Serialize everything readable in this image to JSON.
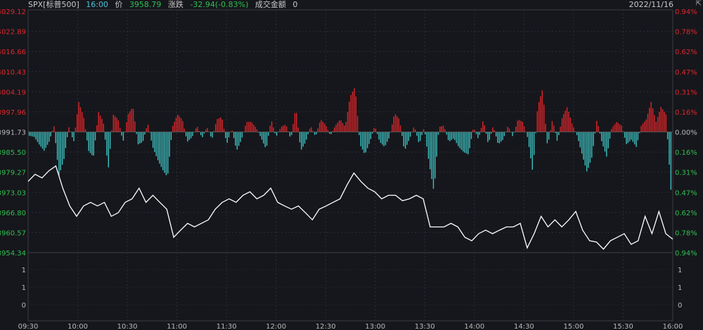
{
  "header": {
    "symbol": "SPX[标普500]",
    "time": "16:00",
    "price_label": "价",
    "price": "3958.79",
    "change_label": "涨跌",
    "change": "-32.94(-0.83%)",
    "turnover_label": "成交金额",
    "turnover": "0",
    "date": "2022/11/16",
    "corner_icon": "expand-icon"
  },
  "colors": {
    "up": "#e0262a",
    "down": "#3ec2c2",
    "line": "#ffffff",
    "grid": "#2c2e36",
    "neutral": "#b8b8b8",
    "green": "#2fbf4f"
  },
  "chart_data": {
    "type": "line",
    "title": "SPX intraday",
    "xlabel": "",
    "ylabel": "",
    "x_ticks": [
      "09:30",
      "10:00",
      "10:30",
      "11:00",
      "11:30",
      "12:00",
      "12:30",
      "13:00",
      "13:30",
      "14:00",
      "14:30",
      "15:00",
      "15:30",
      "16:00"
    ],
    "ylim": [
      3954.34,
      4029.12
    ],
    "prev_close": 3991.73,
    "left_ticks": [
      "4029.12",
      "4022.89",
      "4016.66",
      "4010.43",
      "4004.19",
      "3997.96",
      "3991.73",
      "3985.50",
      "3979.27",
      "3973.03",
      "3966.80",
      "3960.57",
      "3954.34"
    ],
    "right_ticks": [
      "0.94%",
      "0.78%",
      "0.62%",
      "0.47%",
      "0.31%",
      "0.16%",
      "0.00%",
      "0.16%",
      "0.31%",
      "0.47%",
      "0.62%",
      "0.78%",
      "0.94%"
    ],
    "volume_ticks": [
      "1",
      "1",
      "0"
    ],
    "grid": true,
    "price_series": [
      3976.4,
      3978.6,
      3977.5,
      3979.7,
      3981.2,
      3974.3,
      3968.8,
      3965.6,
      3968.8,
      3969.9,
      3968.8,
      3969.9,
      3965.6,
      3966.7,
      3969.9,
      3971.0,
      3974.3,
      3969.9,
      3972.1,
      3969.9,
      3967.8,
      3959.1,
      3961.3,
      3963.4,
      3962.3,
      3963.4,
      3964.5,
      3967.8,
      3969.9,
      3971.0,
      3969.9,
      3972.1,
      3973.2,
      3971.0,
      3972.1,
      3974.3,
      3969.9,
      3968.8,
      3967.8,
      3968.8,
      3966.7,
      3964.5,
      3967.8,
      3968.8,
      3969.9,
      3971.0,
      3975.3,
      3979.0,
      3976.4,
      3974.3,
      3973.2,
      3971.0,
      3972.1,
      3972.1,
      3970.4,
      3971.0,
      3972.1,
      3971.0,
      3962.3,
      3962.3,
      3962.3,
      3963.4,
      3962.3,
      3959.1,
      3958.0,
      3960.2,
      3961.3,
      3960.2,
      3961.3,
      3962.3,
      3962.3,
      3963.4,
      3955.8,
      3960.2,
      3965.6,
      3962.3,
      3964.5,
      3962.3,
      3964.5,
      3967.1,
      3961.3,
      3958.0,
      3957.6,
      3955.4,
      3958.0,
      3959.1,
      3960.2,
      3956.9,
      3958.0,
      3965.6,
      3960.2,
      3967.1,
      3960.2,
      3958.5
    ],
    "series": [
      {
        "name": "change_pct_bars",
        "values": [
          -0.03,
          -0.04,
          -0.1,
          -0.15,
          -0.08,
          0.05,
          -0.35,
          -0.22,
          0.04,
          -0.08,
          0.24,
          0.12,
          -0.15,
          -0.2,
          0.16,
          0.08,
          -0.3,
          0.14,
          0.1,
          -0.08,
          0.14,
          0.2,
          -0.1,
          -0.08,
          0.07,
          -0.12,
          -0.22,
          -0.3,
          -0.36,
          0.04,
          0.14,
          0.1,
          -0.08,
          -0.04,
          0.05,
          -0.05,
          0.04,
          -0.06,
          0.1,
          0.12,
          -0.1,
          0.03,
          -0.15,
          -0.06,
          0.08,
          0.08,
          0.03,
          -0.05,
          -0.14,
          0.1,
          -0.04,
          0.04,
          0.06,
          -0.06,
          0.2,
          -0.15,
          -0.08,
          0.05,
          -0.04,
          0.1,
          0.06,
          -0.03,
          0.05,
          0.1,
          0.04,
          0.28,
          0.36,
          -0.1,
          -0.18,
          -0.08,
          0.05,
          -0.08,
          -0.12,
          -0.04,
          0.15,
          0.1,
          -0.15,
          -0.06,
          0.05,
          -0.1,
          0.04,
          -0.25,
          -0.48,
          0.04,
          0.05,
          -0.08,
          -0.05,
          -0.12,
          -0.16,
          -0.18,
          0.04,
          -0.06,
          0.1,
          -0.1,
          0.05,
          -0.1,
          -0.06,
          0.05,
          -0.04,
          0.1,
          0.08,
          -0.05,
          -0.32,
          0.2,
          0.34,
          -0.12,
          0.1,
          -0.08,
          0.12,
          0.2,
          0.06,
          -0.03,
          -0.18,
          -0.32,
          -0.2,
          0.1,
          -0.08,
          -0.2,
          0.03,
          0.08,
          0.05,
          -0.1,
          -0.06,
          -0.12,
          0.05,
          0.1,
          0.24,
          0.08,
          0.2,
          0.14,
          -0.46
        ]
      }
    ]
  }
}
